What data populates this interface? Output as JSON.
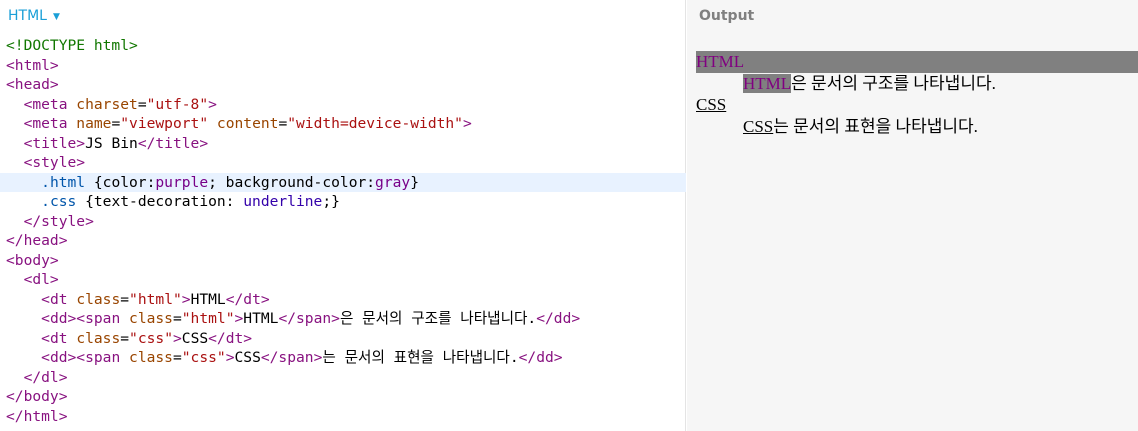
{
  "editor": {
    "tab_label": "HTML",
    "tab_caret": "▼",
    "lines": [
      [
        {
          "c": "t",
          "x": "<!DOCTYPE html>"
        }
      ],
      [
        {
          "c": "tagc",
          "x": "<html>"
        }
      ],
      [
        {
          "c": "tagc",
          "x": "<head>"
        }
      ],
      [
        {
          "c": "p",
          "x": "  "
        },
        {
          "c": "tagc",
          "x": "<meta "
        },
        {
          "c": "attr",
          "x": "charset"
        },
        {
          "c": "p",
          "x": "="
        },
        {
          "c": "str",
          "x": "\"utf-8\""
        },
        {
          "c": "tagc",
          "x": ">"
        }
      ],
      [
        {
          "c": "p",
          "x": "  "
        },
        {
          "c": "tagc",
          "x": "<meta "
        },
        {
          "c": "attr",
          "x": "name"
        },
        {
          "c": "p",
          "x": "="
        },
        {
          "c": "str",
          "x": "\"viewport\""
        },
        {
          "c": "p",
          "x": " "
        },
        {
          "c": "attr",
          "x": "content"
        },
        {
          "c": "p",
          "x": "="
        },
        {
          "c": "str",
          "x": "\"width=device-width\""
        },
        {
          "c": "tagc",
          "x": ">"
        }
      ],
      [
        {
          "c": "p",
          "x": "  "
        },
        {
          "c": "tagc",
          "x": "<title>"
        },
        {
          "c": "p",
          "x": "JS Bin"
        },
        {
          "c": "tagc",
          "x": "</title>"
        }
      ],
      [
        {
          "c": "p",
          "x": "  "
        },
        {
          "c": "tagc",
          "x": "<style>"
        }
      ],
      [
        {
          "c": "p",
          "x": "    "
        },
        {
          "c": "sel",
          "x": ".html"
        },
        {
          "c": "p",
          "x": " {color:"
        },
        {
          "c": "pv",
          "x": "purple"
        },
        {
          "c": "p",
          "x": "; background-color:"
        },
        {
          "c": "pv",
          "x": "gray"
        },
        {
          "c": "p",
          "x": "}"
        }
      ],
      [
        {
          "c": "p",
          "x": "    "
        },
        {
          "c": "sel",
          "x": ".css"
        },
        {
          "c": "p",
          "x": " {text-decoration: "
        },
        {
          "c": "val",
          "x": "underline"
        },
        {
          "c": "p",
          "x": ";}"
        }
      ],
      [
        {
          "c": "p",
          "x": "  "
        },
        {
          "c": "tagc",
          "x": "</style>"
        }
      ],
      [
        {
          "c": "tagc",
          "x": "</head>"
        }
      ],
      [
        {
          "c": "tagc",
          "x": "<body>"
        }
      ],
      [
        {
          "c": "p",
          "x": "  "
        },
        {
          "c": "tagc",
          "x": "<dl>"
        }
      ],
      [
        {
          "c": "p",
          "x": "    "
        },
        {
          "c": "tagc",
          "x": "<dt "
        },
        {
          "c": "attr",
          "x": "class"
        },
        {
          "c": "p",
          "x": "="
        },
        {
          "c": "str",
          "x": "\"html\""
        },
        {
          "c": "tagc",
          "x": ">"
        },
        {
          "c": "p",
          "x": "HTML"
        },
        {
          "c": "tagc",
          "x": "</dt>"
        }
      ],
      [
        {
          "c": "p",
          "x": "    "
        },
        {
          "c": "tagc",
          "x": "<dd><span "
        },
        {
          "c": "attr",
          "x": "class"
        },
        {
          "c": "p",
          "x": "="
        },
        {
          "c": "str",
          "x": "\"html\""
        },
        {
          "c": "tagc",
          "x": ">"
        },
        {
          "c": "p",
          "x": "HTML"
        },
        {
          "c": "tagc",
          "x": "</span>"
        },
        {
          "c": "p",
          "x": "은 문서의 구조를 나타냅니다."
        },
        {
          "c": "tagc",
          "x": "</dd>"
        }
      ],
      [
        {
          "c": "p",
          "x": "    "
        },
        {
          "c": "tagc",
          "x": "<dt "
        },
        {
          "c": "attr",
          "x": "class"
        },
        {
          "c": "p",
          "x": "="
        },
        {
          "c": "str",
          "x": "\"css\""
        },
        {
          "c": "tagc",
          "x": ">"
        },
        {
          "c": "p",
          "x": "CSS"
        },
        {
          "c": "tagc",
          "x": "</dt>"
        }
      ],
      [
        {
          "c": "p",
          "x": "    "
        },
        {
          "c": "tagc",
          "x": "<dd><span "
        },
        {
          "c": "attr",
          "x": "class"
        },
        {
          "c": "p",
          "x": "="
        },
        {
          "c": "str",
          "x": "\"css\""
        },
        {
          "c": "tagc",
          "x": ">"
        },
        {
          "c": "p",
          "x": "CSS"
        },
        {
          "c": "tagc",
          "x": "</span>"
        },
        {
          "c": "p",
          "x": "는 문서의 표현을 나타냅니다."
        },
        {
          "c": "tagc",
          "x": "</dd>"
        }
      ],
      [
        {
          "c": "p",
          "x": "  "
        },
        {
          "c": "tagc",
          "x": "</dl>"
        }
      ],
      [
        {
          "c": "tagc",
          "x": "</body>"
        }
      ],
      [
        {
          "c": "tagc",
          "x": "</html>"
        }
      ]
    ],
    "active_line": 7
  },
  "output": {
    "title": "Output",
    "dt_html": "HTML",
    "dd_html_span": "HTML",
    "dd_html_rest": "은 문서의 구조를 나타냅니다.",
    "dt_css": "CSS",
    "dd_css_span": "CSS",
    "dd_css_rest": "는 문서의 표현을 나타냅니다."
  }
}
